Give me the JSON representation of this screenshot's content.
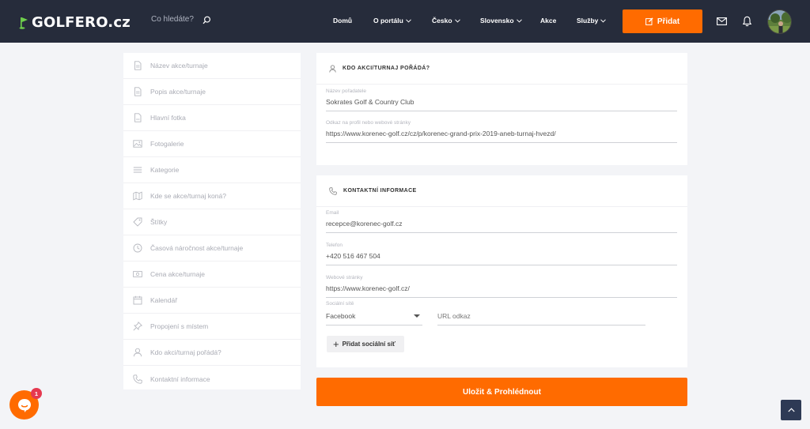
{
  "header": {
    "logo": {
      "text": "GOLFERO.cz",
      "icon": "golf-flag-icon",
      "color": "#6fd04c"
    },
    "search_placeholder": "Co hledáte?",
    "nav": [
      {
        "label": "Domů"
      },
      {
        "label": "O portálu",
        "dropdown": true
      },
      {
        "label": "Česko",
        "dropdown": true
      },
      {
        "label": "Slovensko",
        "dropdown": true
      },
      {
        "label": "Akce"
      },
      {
        "label": "Služby",
        "dropdown": true
      }
    ],
    "add_button": "Přidat",
    "accent": "#ff6b00",
    "bg": "#262c3b"
  },
  "sidebar": {
    "items": [
      {
        "label": "Název akce/turnaje",
        "icon": "document-icon"
      },
      {
        "label": "Popis akce/turnaje",
        "icon": "document-icon"
      },
      {
        "label": "Hlavní fotka",
        "icon": "document-icon"
      },
      {
        "label": "Fotogalerie",
        "icon": "image-icon"
      },
      {
        "label": "Kategorie",
        "icon": "list-icon"
      },
      {
        "label": "Kde se akce/turnaj koná?",
        "icon": "map-icon"
      },
      {
        "label": "Štítky",
        "icon": "tag-icon"
      },
      {
        "label": "Časová náročnost akce/turnaje",
        "icon": "clock-icon"
      },
      {
        "label": "Cena akce/turnaje",
        "icon": "money-icon"
      },
      {
        "label": "Kalendář",
        "icon": "calendar-icon"
      },
      {
        "label": "Propojení s místem",
        "icon": "pin-icon"
      },
      {
        "label": "Kdo akci/turnaj pořádá?",
        "icon": "user-icon"
      },
      {
        "label": "Kontaktní informace",
        "icon": "phone-icon"
      }
    ]
  },
  "organizer": {
    "title": "KDO AKCI/TURNAJ POŘÁDÁ?",
    "name_label": "Název pořadatele",
    "name_value": "Sokrates Golf & Country Club",
    "link_label": "Odkaz na profil nebo webové stránky",
    "link_value": "https://www.korenec-golf.cz/cz/p/korenec-grand-prix-2019-aneb-turnaj-hvezd/"
  },
  "contact": {
    "title": "KONTAKTNÍ INFORMACE",
    "email_label": "Email",
    "email_value": "recepce@korenec-golf.cz",
    "phone_label": "Telefon",
    "phone_value": "+420 516 467 504",
    "web_label": "Webové stránky",
    "web_value": "https://www.korenec-golf.cz/",
    "social_label": "Sociální sítě",
    "social_selected": "Facebook",
    "url_placeholder": "URL odkaz",
    "add_social": "Přidat sociální síť"
  },
  "save_button": "Uložit & Prohlédnout",
  "chat_badge": "1"
}
